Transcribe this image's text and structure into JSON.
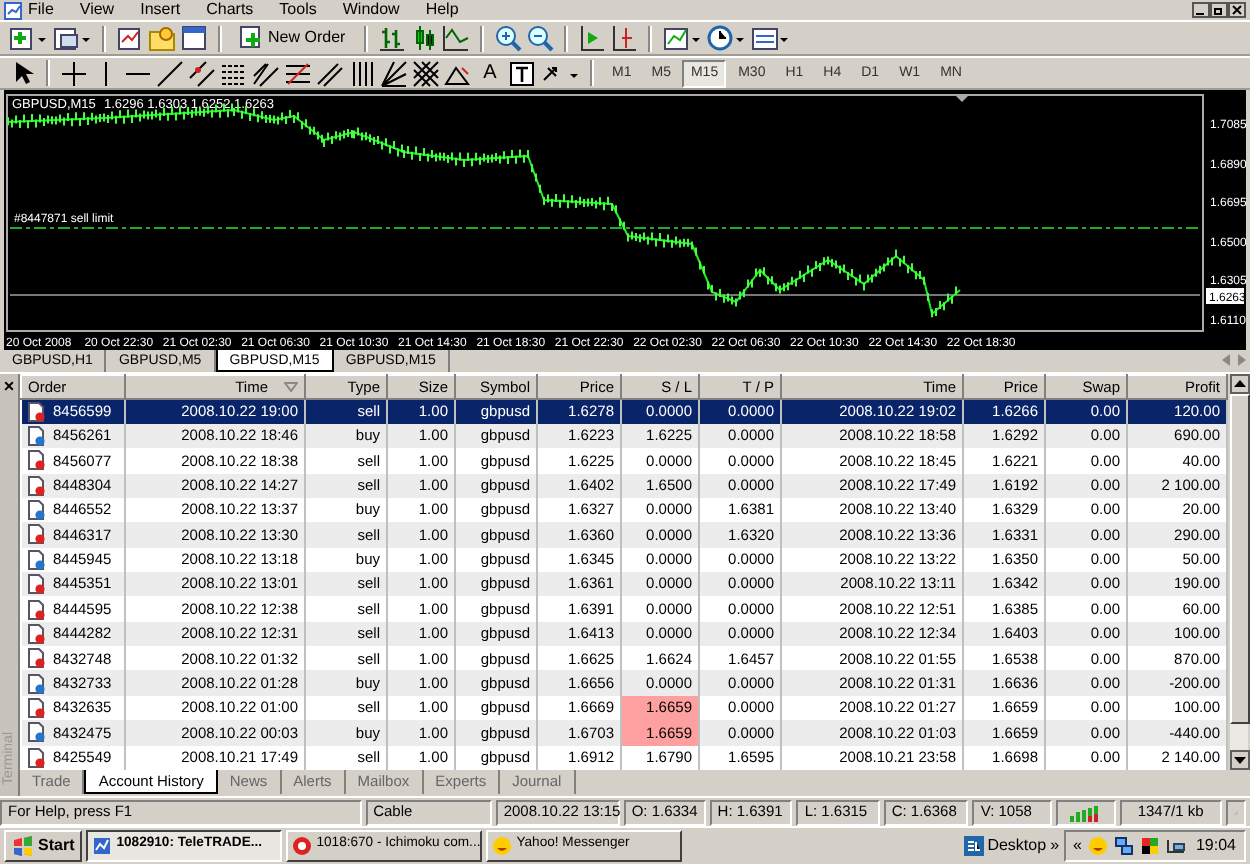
{
  "menu": [
    "File",
    "View",
    "Insert",
    "Charts",
    "Tools",
    "Window",
    "Help"
  ],
  "toolbar": {
    "new_order": "New Order",
    "text_tool": "A",
    "timeframes": [
      {
        "label": "M1",
        "selected": false
      },
      {
        "label": "M5",
        "selected": false
      },
      {
        "label": "M15",
        "selected": true
      },
      {
        "label": "M30",
        "selected": false
      },
      {
        "label": "H1",
        "selected": false
      },
      {
        "label": "H4",
        "selected": false
      },
      {
        "label": "D1",
        "selected": false
      },
      {
        "label": "W1",
        "selected": false
      },
      {
        "label": "MN",
        "selected": false
      }
    ]
  },
  "chart": {
    "title": "GBPUSD,M15",
    "ohlc": "1.6296 1.6303 1.6252 1.6263",
    "order_line": "#8447871 sell limit",
    "bid_price": "1.6263",
    "price_labels": [
      "1.7085",
      "1.6890",
      "1.6695",
      "1.6500",
      "1.6305",
      "1.6110"
    ],
    "time_labels": [
      "20 Oct 2008",
      "20 Oct 22:30",
      "21 Oct 02:30",
      "21 Oct 06:30",
      "21 Oct 10:30",
      "21 Oct 14:30",
      "21 Oct 18:30",
      "21 Oct 22:30",
      "22 Oct 02:30",
      "22 Oct 06:30",
      "22 Oct 10:30",
      "22 Oct 14:30",
      "22 Oct 18:30"
    ]
  },
  "chart_tabs": [
    {
      "label": "GBPUSD,H1",
      "selected": false
    },
    {
      "label": "GBPUSD,M5",
      "selected": false
    },
    {
      "label": "GBPUSD,M15",
      "selected": true
    },
    {
      "label": "GBPUSD,M15",
      "selected": false
    }
  ],
  "terminal": {
    "title": "Terminal",
    "close": "×",
    "columns": [
      "Order",
      "Time",
      "Type",
      "Size",
      "Symbol",
      "Price",
      "S / L",
      "T / P",
      "Time",
      "Price",
      "Swap",
      "Profit"
    ],
    "rows": [
      {
        "kind": "sell",
        "selected": true,
        "sl_alert": false,
        "cells": [
          "8456599",
          "2008.10.22 19:00",
          "sell",
          "1.00",
          "gbpusd",
          "1.6278",
          "0.0000",
          "0.0000",
          "2008.10.22 19:02",
          "1.6266",
          "0.00",
          "120.00"
        ]
      },
      {
        "kind": "buy",
        "selected": false,
        "sl_alert": false,
        "cells": [
          "8456261",
          "2008.10.22 18:46",
          "buy",
          "1.00",
          "gbpusd",
          "1.6223",
          "1.6225",
          "0.0000",
          "2008.10.22 18:58",
          "1.6292",
          "0.00",
          "690.00"
        ]
      },
      {
        "kind": "sell",
        "selected": false,
        "sl_alert": false,
        "cells": [
          "8456077",
          "2008.10.22 18:38",
          "sell",
          "1.00",
          "gbpusd",
          "1.6225",
          "0.0000",
          "0.0000",
          "2008.10.22 18:45",
          "1.6221",
          "0.00",
          "40.00"
        ]
      },
      {
        "kind": "sell",
        "selected": false,
        "sl_alert": false,
        "cells": [
          "8448304",
          "2008.10.22 14:27",
          "sell",
          "1.00",
          "gbpusd",
          "1.6402",
          "1.6500",
          "0.0000",
          "2008.10.22 17:49",
          "1.6192",
          "0.00",
          "2 100.00"
        ]
      },
      {
        "kind": "buy",
        "selected": false,
        "sl_alert": false,
        "cells": [
          "8446552",
          "2008.10.22 13:37",
          "buy",
          "1.00",
          "gbpusd",
          "1.6327",
          "0.0000",
          "1.6381",
          "2008.10.22 13:40",
          "1.6329",
          "0.00",
          "20.00"
        ]
      },
      {
        "kind": "sell",
        "selected": false,
        "sl_alert": false,
        "cells": [
          "8446317",
          "2008.10.22 13:30",
          "sell",
          "1.00",
          "gbpusd",
          "1.6360",
          "0.0000",
          "1.6320",
          "2008.10.22 13:36",
          "1.6331",
          "0.00",
          "290.00"
        ]
      },
      {
        "kind": "buy",
        "selected": false,
        "sl_alert": false,
        "cells": [
          "8445945",
          "2008.10.22 13:18",
          "buy",
          "1.00",
          "gbpusd",
          "1.6345",
          "0.0000",
          "0.0000",
          "2008.10.22 13:22",
          "1.6350",
          "0.00",
          "50.00"
        ]
      },
      {
        "kind": "sell",
        "selected": false,
        "sl_alert": false,
        "cells": [
          "8445351",
          "2008.10.22 13:01",
          "sell",
          "1.00",
          "gbpusd",
          "1.6361",
          "0.0000",
          "0.0000",
          "2008.10.22 13:11",
          "1.6342",
          "0.00",
          "190.00"
        ]
      },
      {
        "kind": "sell",
        "selected": false,
        "sl_alert": false,
        "cells": [
          "8444595",
          "2008.10.22 12:38",
          "sell",
          "1.00",
          "gbpusd",
          "1.6391",
          "0.0000",
          "0.0000",
          "2008.10.22 12:51",
          "1.6385",
          "0.00",
          "60.00"
        ]
      },
      {
        "kind": "sell",
        "selected": false,
        "sl_alert": false,
        "cells": [
          "8444282",
          "2008.10.22 12:31",
          "sell",
          "1.00",
          "gbpusd",
          "1.6413",
          "0.0000",
          "0.0000",
          "2008.10.22 12:34",
          "1.6403",
          "0.00",
          "100.00"
        ]
      },
      {
        "kind": "sell",
        "selected": false,
        "sl_alert": false,
        "cells": [
          "8432748",
          "2008.10.22 01:32",
          "sell",
          "1.00",
          "gbpusd",
          "1.6625",
          "1.6624",
          "1.6457",
          "2008.10.22 01:55",
          "1.6538",
          "0.00",
          "870.00"
        ]
      },
      {
        "kind": "buy",
        "selected": false,
        "sl_alert": false,
        "cells": [
          "8432733",
          "2008.10.22 01:28",
          "buy",
          "1.00",
          "gbpusd",
          "1.6656",
          "0.0000",
          "0.0000",
          "2008.10.22 01:31",
          "1.6636",
          "0.00",
          "-200.00"
        ]
      },
      {
        "kind": "sell",
        "selected": false,
        "sl_alert": true,
        "cells": [
          "8432635",
          "2008.10.22 01:00",
          "sell",
          "1.00",
          "gbpusd",
          "1.6669",
          "1.6659",
          "0.0000",
          "2008.10.22 01:27",
          "1.6659",
          "0.00",
          "100.00"
        ]
      },
      {
        "kind": "buy",
        "selected": false,
        "sl_alert": true,
        "cells": [
          "8432475",
          "2008.10.22 00:03",
          "buy",
          "1.00",
          "gbpusd",
          "1.6703",
          "1.6659",
          "0.0000",
          "2008.10.22 01:03",
          "1.6659",
          "0.00",
          "-440.00"
        ]
      },
      {
        "kind": "sell",
        "selected": false,
        "sl_alert": false,
        "cells": [
          "8425549",
          "2008.10.21 17:49",
          "sell",
          "1.00",
          "gbpusd",
          "1.6912",
          "1.6790",
          "1.6595",
          "2008.10.21 23:58",
          "1.6698",
          "0.00",
          "2 140.00"
        ]
      }
    ],
    "tabs": [
      {
        "label": "Trade",
        "selected": false
      },
      {
        "label": "Account History",
        "selected": true
      },
      {
        "label": "News",
        "selected": false
      },
      {
        "label": "Alerts",
        "selected": false
      },
      {
        "label": "Mailbox",
        "selected": false
      },
      {
        "label": "Experts",
        "selected": false
      },
      {
        "label": "Journal",
        "selected": false
      }
    ]
  },
  "status_bar": {
    "help": "For Help, press F1",
    "profile": "Cable",
    "time": "2008.10.22 13:15",
    "open": "O: 1.6334",
    "high": "H: 1.6391",
    "low": "L: 1.6315",
    "close": "C: 1.6368",
    "volume": "V: 1058",
    "traffic": "1347/1 kb"
  },
  "taskbar": {
    "start": "Start",
    "tasks": [
      {
        "label": "1082910: TeleTRADE...",
        "selected": true
      },
      {
        "label": "1018:670 - Ichimoku com...",
        "selected": false
      },
      {
        "label": "Yahoo! Messenger",
        "selected": false
      }
    ],
    "desktop": "Desktop",
    "chevron": "»",
    "tray_chevron": "«",
    "clock": "19:04"
  }
}
